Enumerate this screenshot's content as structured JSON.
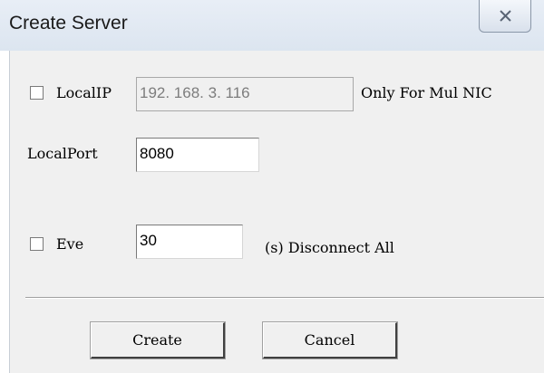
{
  "window": {
    "title": "Create Server",
    "close_icon": "close-icon"
  },
  "local_ip": {
    "checked": false,
    "label": "LocalIP",
    "value": "192. 168. 3. 116",
    "enabled": false,
    "note": "Only For Mul NIC"
  },
  "local_port": {
    "label": "LocalPort",
    "value": "8080"
  },
  "every": {
    "checked": false,
    "label": "Eve",
    "value": "30",
    "suffix": "(s) Disconnect All"
  },
  "buttons": {
    "create_label": "Create",
    "cancel_label": "Cancel"
  },
  "colors": {
    "titlebar": "#dce5f0",
    "dialog_bg": "#f0f0f0",
    "disabled_text": "#7d7d7d"
  }
}
